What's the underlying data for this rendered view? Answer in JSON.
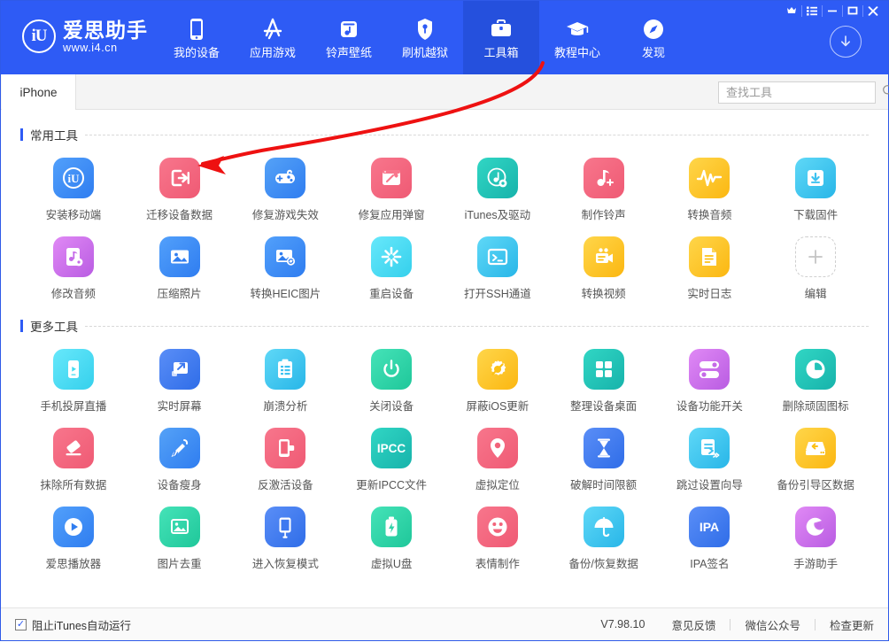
{
  "app": {
    "logo_cn": "爱思助手",
    "logo_url": "www.i4.cn",
    "logo_mark": "iU"
  },
  "header": {
    "nav": [
      {
        "label": "我的设备",
        "icon": "phone-icon",
        "active": false
      },
      {
        "label": "应用游戏",
        "icon": "appstore-icon",
        "active": false
      },
      {
        "label": "铃声壁纸",
        "icon": "music-box-icon",
        "active": false
      },
      {
        "label": "刷机越狱",
        "icon": "shield-key-icon",
        "active": false
      },
      {
        "label": "工具箱",
        "icon": "toolbox-icon",
        "active": true
      },
      {
        "label": "教程中心",
        "icon": "graduation-cap-icon",
        "active": false
      },
      {
        "label": "发现",
        "icon": "compass-icon",
        "active": false
      }
    ],
    "window_controls": [
      "vip-crown-icon",
      "menu-list-icon",
      "minimize-icon",
      "maximize-icon",
      "close-icon"
    ],
    "download_button": "download-arrow-icon"
  },
  "tabs": {
    "items": [
      {
        "label": "iPhone",
        "active": true
      }
    ]
  },
  "search": {
    "placeholder": "查找工具",
    "value": "",
    "icon": "search-icon"
  },
  "sections": [
    {
      "title": "常用工具",
      "tools": [
        {
          "label": "安装移动端",
          "icon": "i4-logo-icon",
          "color": "#3f8cf7"
        },
        {
          "label": "迁移设备数据",
          "icon": "migrate-icon",
          "color": "#f2637a"
        },
        {
          "label": "修复游戏失效",
          "icon": "gamepad-icon",
          "color": "#3d8ef0"
        },
        {
          "label": "修复应用弹窗",
          "icon": "window-wrench-icon",
          "color": "#f2637a"
        },
        {
          "label": "iTunes及驱动",
          "icon": "itunes-gear-icon",
          "color": "#22c3b8"
        },
        {
          "label": "制作铃声",
          "icon": "note-plus-icon",
          "color": "#f2637a"
        },
        {
          "label": "转换音频",
          "icon": "waveform-icon",
          "color": "#fcc014"
        },
        {
          "label": "下载固件",
          "icon": "download-box-icon",
          "color": "#3ec2f0"
        },
        {
          "label": "修改音频",
          "icon": "audio-file-gear-icon",
          "color": "#c56ae8"
        },
        {
          "label": "压缩照片",
          "icon": "photo-icon",
          "color": "#2f7df0"
        },
        {
          "label": "转换HEIC图片",
          "icon": "photo-convert-icon",
          "color": "#2f7df0"
        },
        {
          "label": "重启设备",
          "icon": "restart-burst-icon",
          "color": "#3fdcf0"
        },
        {
          "label": "打开SSH通道",
          "icon": "terminal-icon",
          "color": "#3ec2f0"
        },
        {
          "label": "转换视频",
          "icon": "video-convert-icon",
          "color": "#fcc014"
        },
        {
          "label": "实时日志",
          "icon": "document-lines-icon",
          "color": "#fcc014"
        },
        {
          "label": "编辑",
          "icon": "plus-icon",
          "color": "#cfcfcf"
        }
      ]
    },
    {
      "title": "更多工具",
      "tools": [
        {
          "label": "手机投屏直播",
          "icon": "phone-play-icon",
          "color": "#3fdcf0"
        },
        {
          "label": "实时屏幕",
          "icon": "screen-arrow-icon",
          "color": "#3d79f0"
        },
        {
          "label": "崩溃分析",
          "icon": "clipboard-list-icon",
          "color": "#3ec2f0"
        },
        {
          "label": "关闭设备",
          "icon": "power-icon",
          "color": "#2fd3a8"
        },
        {
          "label": "屏蔽iOS更新",
          "icon": "gear-block-icon",
          "color": "#fcc014"
        },
        {
          "label": "整理设备桌面",
          "icon": "grid-squares-icon",
          "color": "#22c3b8"
        },
        {
          "label": "设备功能开关",
          "icon": "toggles-icon",
          "color": "#c56ae8"
        },
        {
          "label": "删除顽固图标",
          "icon": "clock-icon",
          "color": "#22c3b8"
        },
        {
          "label": "抹除所有数据",
          "icon": "eraser-icon",
          "color": "#f2637a"
        },
        {
          "label": "设备瘦身",
          "icon": "broom-icon",
          "color": "#3d8ef0"
        },
        {
          "label": "反激活设备",
          "icon": "phone-unplug-icon",
          "color": "#f2637a"
        },
        {
          "label": "更新IPCC文件",
          "icon": "ipcc-text-icon",
          "color": "#22c3b8"
        },
        {
          "label": "虚拟定位",
          "icon": "map-pin-icon",
          "color": "#f2637a"
        },
        {
          "label": "破解时间限额",
          "icon": "hourglass-icon",
          "color": "#3d8ef0"
        },
        {
          "label": "跳过设置向导",
          "icon": "skip-setup-icon",
          "color": "#3ec2f0"
        },
        {
          "label": "备份引导区数据",
          "icon": "drive-restore-icon",
          "color": "#fcc014"
        },
        {
          "label": "爱思播放器",
          "icon": "play-circle-icon",
          "color": "#2f7df0"
        },
        {
          "label": "图片去重",
          "icon": "photo-dedupe-icon",
          "color": "#2fd3a8"
        },
        {
          "label": "进入恢复模式",
          "icon": "phone-cable-icon",
          "color": "#3d79f0"
        },
        {
          "label": "虚拟U盘",
          "icon": "usb-flash-icon",
          "color": "#2fd3a8"
        },
        {
          "label": "表情制作",
          "icon": "smiley-icon",
          "color": "#f2637a"
        },
        {
          "label": "备份/恢复数据",
          "icon": "umbrella-icon",
          "color": "#3ec2f0"
        },
        {
          "label": "IPA签名",
          "icon": "ipa-text-icon",
          "color": "#3d79f0"
        },
        {
          "label": "手游助手",
          "icon": "game-swirl-icon",
          "color": "#c56ae8"
        }
      ]
    }
  ],
  "footer": {
    "checkbox_label": "阻止iTunes自动运行",
    "checkbox_checked": true,
    "version": "V7.98.10",
    "links": [
      "意见反馈",
      "微信公众号",
      "检查更新"
    ]
  },
  "annotation": {
    "type": "red-arrow",
    "color": "#ee1111",
    "from": "工具箱",
    "to": "迁移设备数据"
  },
  "colors": {
    "brand": "#2e5bf5",
    "brand_active": "#2550dd",
    "annotation": "#ee1111"
  }
}
